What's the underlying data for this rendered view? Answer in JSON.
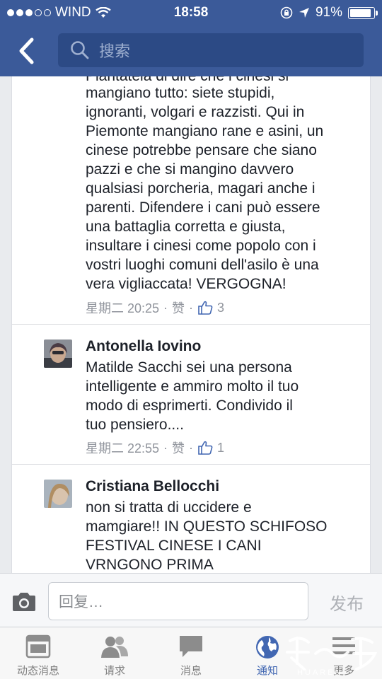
{
  "status_bar": {
    "carrier": "WIND",
    "time": "18:58",
    "battery": "91%",
    "battery_level": 0.91
  },
  "header": {
    "back_icon": "chevron-left-icon",
    "search_placeholder": "搜索",
    "search_icon": "search-icon"
  },
  "comments": [
    {
      "author": "",
      "text_partial_top": "Piantatela di dire che i cinesi si",
      "text": "mangiano tutto: siete stupidi,\nignoranti, volgari e razzisti. Qui in\nPiemonte mangiano rane e asini, un\ncinese potrebbe pensare che siano\npazzi e che si mangino davvero\nqualsiasi porcheria, magari anche i\nparenti. Difendere i cani può essere\nuna battaglia corretta e giusta,\ninsultare i cinesi come popolo con i\nvostri luoghi comuni dell'asilo è una\nvera vigliaccata! VERGOGNA!",
      "timestamp": "星期二 20:25",
      "like_label": "赞",
      "like_count": "3"
    },
    {
      "author": "Antonella Iovino",
      "text": "Matilde Sacchi sei una persona\nintelligente e ammiro molto il tuo\nmodo di esprimerti.  Condivido il\ntuo pensiero....",
      "timestamp": "星期二 22:55",
      "like_label": "赞",
      "like_count": "1"
    },
    {
      "author": "Cristiana Bellocchi",
      "text": "non si tratta di uccidere e\nmamgiare!! IN QUESTO SCHIFOSO\nFESTIVAL CINESE I CANI\nVRNGONO PRIMA"
    }
  ],
  "reply_bar": {
    "placeholder": "回复…",
    "send_label": "发布"
  },
  "tabs": [
    {
      "label": "动态消息",
      "icon": "news-feed-icon"
    },
    {
      "label": "请求",
      "icon": "friend-requests-icon"
    },
    {
      "label": "消息",
      "icon": "messages-icon"
    },
    {
      "label": "通知",
      "icon": "globe-icon",
      "active": true
    },
    {
      "label": "更多",
      "icon": "menu-icon"
    }
  ],
  "watermark_text": "HUAREN"
}
